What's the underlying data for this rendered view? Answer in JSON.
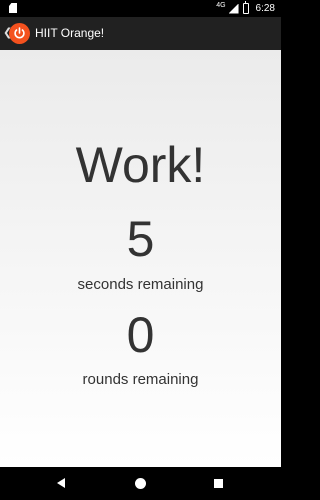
{
  "status_bar": {
    "network": "4G",
    "time": "6:28"
  },
  "app_bar": {
    "title": "HIIT Orange!"
  },
  "timer": {
    "phase": "Work!",
    "seconds_value": "5",
    "seconds_label": "seconds remaining",
    "rounds_value": "0",
    "rounds_label": "rounds remaining"
  },
  "colors": {
    "app_bar_bg": "#212121",
    "logo": "#f4511e",
    "text": "#333333"
  },
  "icons": {
    "status": [
      "sd-card-icon",
      "signal-icon",
      "battery-icon"
    ],
    "app_bar": [
      "back-icon",
      "timer-logo-icon"
    ],
    "nav": [
      "nav-back-icon",
      "nav-home-icon",
      "nav-recents-icon"
    ]
  }
}
